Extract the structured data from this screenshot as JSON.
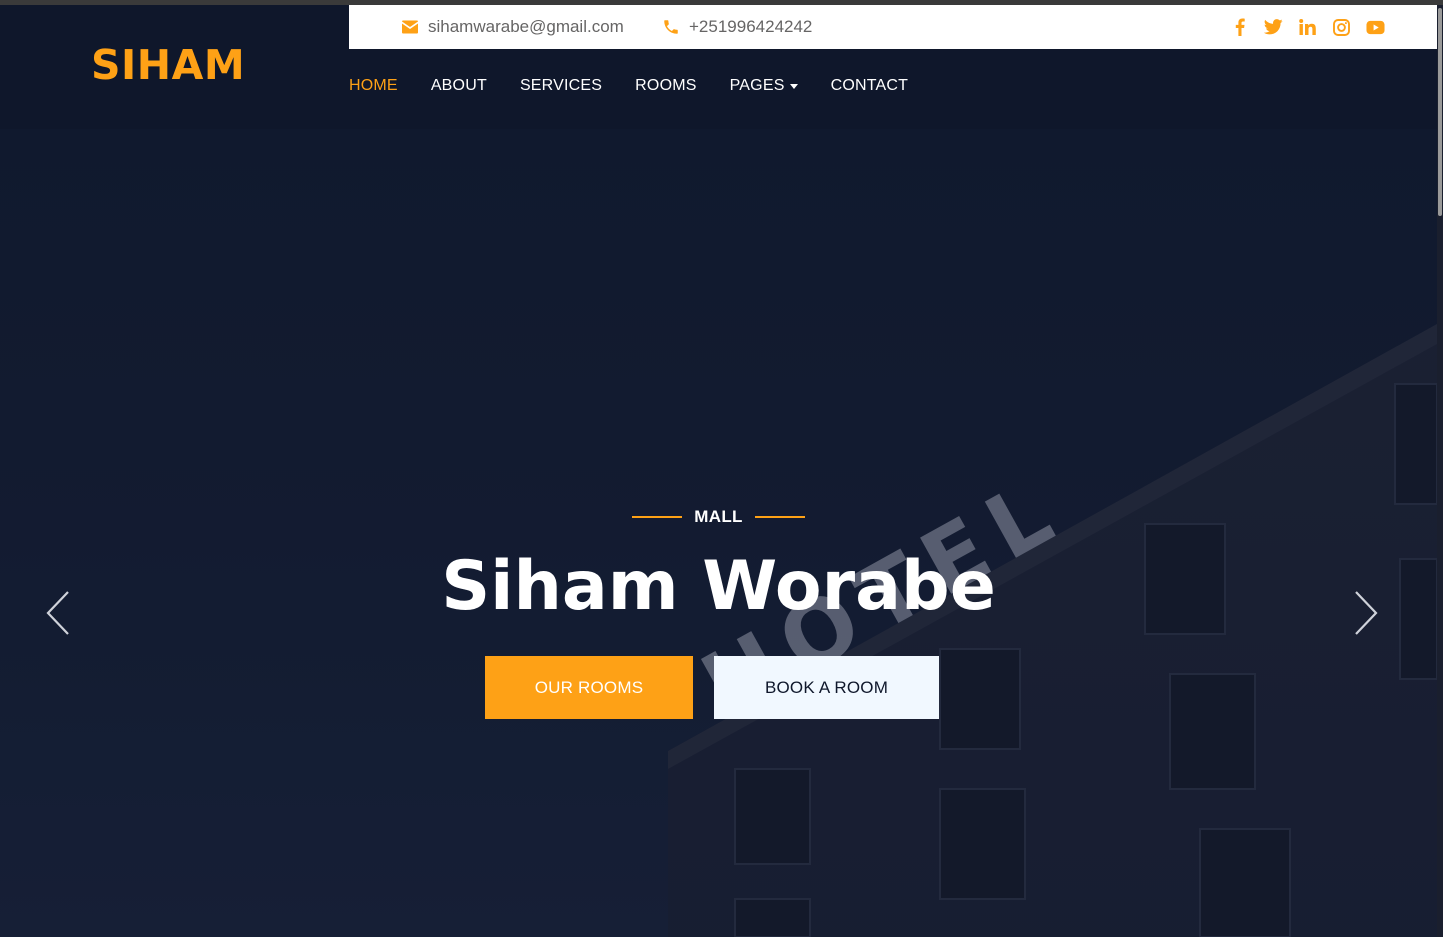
{
  "brand": {
    "name": "SIHAM"
  },
  "topbar": {
    "email": "sihamwarabe@gmail.com",
    "phone": "+251996424242",
    "socials": [
      "facebook-icon",
      "twitter-icon",
      "linkedin-icon",
      "instagram-icon",
      "youtube-icon"
    ]
  },
  "nav": {
    "items": [
      {
        "label": "HOME",
        "active": true
      },
      {
        "label": "ABOUT"
      },
      {
        "label": "SERVICES"
      },
      {
        "label": "ROOMS"
      },
      {
        "label": "PAGES",
        "dropdown": true
      },
      {
        "label": "CONTACT"
      }
    ]
  },
  "hero": {
    "kicker": "MALL",
    "title": "Siham Worabe",
    "primary_button": "OUR ROOMS",
    "secondary_button": "BOOK A ROOM",
    "sign_text": "HOTEL"
  },
  "colors": {
    "accent": "#fea116",
    "dark": "#0f172b",
    "light_button": "#f1f8ff"
  }
}
